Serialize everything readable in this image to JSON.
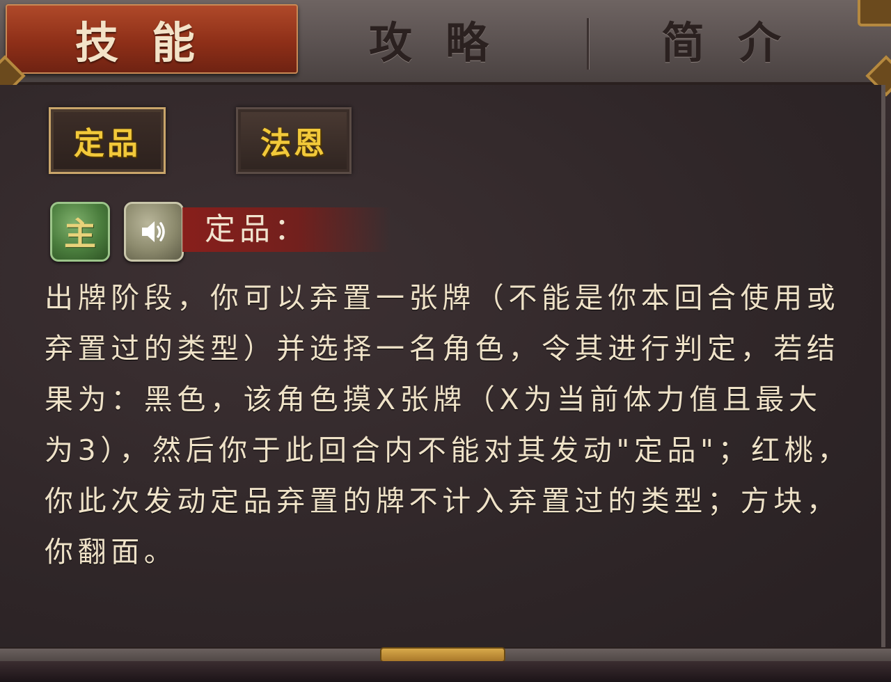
{
  "tabs": [
    {
      "label": "技能",
      "active": true
    },
    {
      "label": "攻略",
      "active": false
    },
    {
      "label": "简介",
      "active": false
    }
  ],
  "skills": [
    {
      "label": "定品",
      "selected": true
    },
    {
      "label": "法恩",
      "selected": false
    }
  ],
  "skill_detail": {
    "badge_main": "主",
    "sound_icon": "speaker-icon",
    "title": "定品：",
    "description": "出牌阶段，你可以弃置一张牌（不能是你本回合使用或弃置过的类型）并选择一名角色，令其进行判定，若结果为：黑色，该角色摸X张牌（X为当前体力值且最大为3），然后你于此回合内不能对其发动\"定品\"；红桃，你此次发动定品弃置的牌不计入弃置过的类型；方块，你翻面。"
  },
  "colors": {
    "active_tab": "#8e2f18",
    "skill_text": "#f2c93a",
    "desc_text": "#efe2c8",
    "badge_green": "#4a7d3d"
  }
}
